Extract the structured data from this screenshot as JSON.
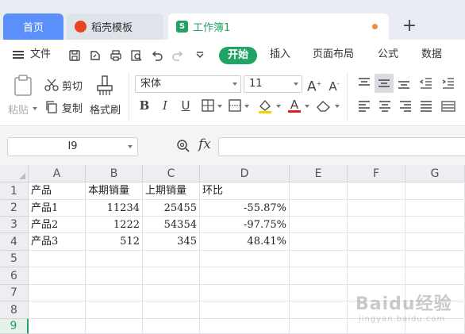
{
  "tabs": [
    {
      "label": "首页"
    },
    {
      "label": "稻壳模板"
    },
    {
      "label": "工作簿1"
    }
  ],
  "tab_add": "+",
  "menu": {
    "file": "文件",
    "items": [
      "开始",
      "插入",
      "页面布局",
      "公式",
      "数据"
    ]
  },
  "ribbon": {
    "paste": "粘贴",
    "cut": "剪切",
    "copy": "复制",
    "format_painter": "格式刷",
    "font": "宋体",
    "font_size": "11",
    "bold": "B",
    "italic": "I",
    "underline": "U",
    "increase_font": "A",
    "decrease_font": "A",
    "font_color": "A"
  },
  "formula_bar": {
    "cell_ref": "I9",
    "fx": "fx",
    "value": ""
  },
  "sheet": {
    "columns": [
      "A",
      "B",
      "C",
      "D",
      "E",
      "F",
      "G"
    ],
    "rows": [
      "1",
      "2",
      "3",
      "4",
      "5",
      "6",
      "7",
      "8",
      "9"
    ],
    "selected_row": "9",
    "header": [
      "产品",
      "本期销量",
      "上期销量",
      "环比"
    ],
    "data": [
      [
        "产品1",
        "11234",
        "25455",
        "-55.87%"
      ],
      [
        "产品2",
        "1222",
        "54354",
        "-97.75%"
      ],
      [
        "产品3",
        "512",
        "345",
        "48.41%"
      ]
    ]
  },
  "watermark": {
    "main": "Baidu经验",
    "sub": "jingyan.baidu.com"
  },
  "colors": {
    "accent": "#21a366",
    "tab_home": "#5b8ff9",
    "unsaved": "#f08d3c"
  }
}
